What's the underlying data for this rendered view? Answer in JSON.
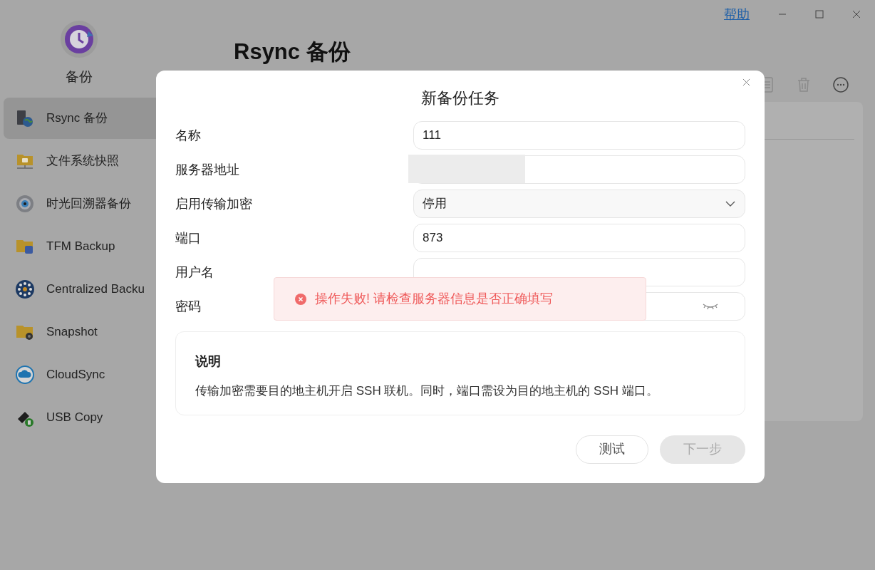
{
  "app": {
    "name": "备份",
    "help": "帮助"
  },
  "sidebar": {
    "items": [
      {
        "label": "Rsync 备份",
        "selected": true
      },
      {
        "label": "文件系统快照",
        "selected": false
      },
      {
        "label": "时光回溯器备份",
        "selected": false
      },
      {
        "label": "TFM Backup",
        "selected": false
      },
      {
        "label": "Centralized Backu",
        "selected": false
      },
      {
        "label": "Snapshot",
        "selected": false
      },
      {
        "label": "CloudSync",
        "selected": false
      },
      {
        "label": "USB Copy",
        "selected": false
      }
    ]
  },
  "page": {
    "title": "Rsync 备份"
  },
  "dialog": {
    "title": "新备份任务",
    "fields": [
      {
        "label": "名称",
        "kind": "text",
        "value": "111"
      },
      {
        "label": "服务器地址",
        "kind": "redacted"
      },
      {
        "label": "启用传输加密",
        "kind": "select",
        "value": "停用"
      },
      {
        "label": "端口",
        "kind": "text",
        "value": "873"
      },
      {
        "label": "用户名",
        "kind": "text"
      },
      {
        "label": "密码",
        "kind": "password"
      }
    ],
    "note": {
      "title": "说明",
      "text": "传输加密需要目的地主机开启 SSH 联机。同时，端口需设为目的地主机的 SSH 端口。"
    },
    "buttons": [
      {
        "label": "测试",
        "disabled": false
      },
      {
        "label": "下一步",
        "disabled": true
      }
    ]
  },
  "toast": {
    "message": "操作失败! 请检查服务器信息是否正确填写"
  }
}
